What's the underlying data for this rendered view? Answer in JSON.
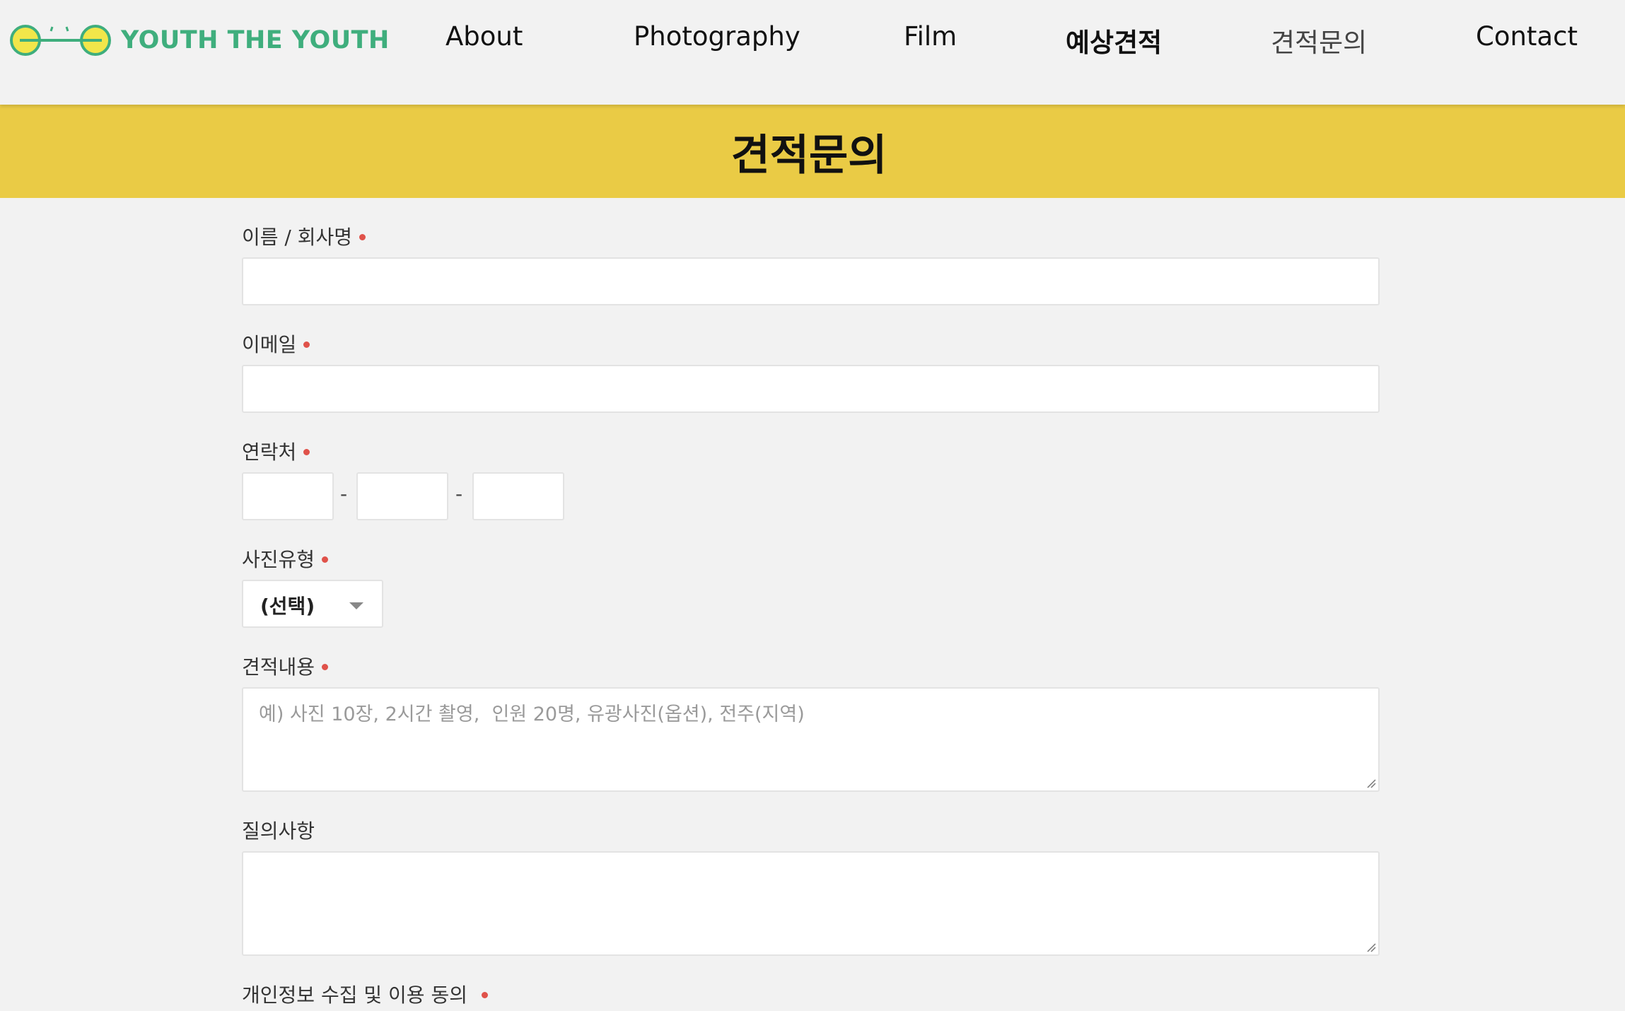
{
  "header": {
    "logo_text": "YOUTH THE YOUTH",
    "nav": [
      {
        "label": "About"
      },
      {
        "label": "Photography"
      },
      {
        "label": "Film"
      },
      {
        "label": "예상견적"
      },
      {
        "label": "견적문의"
      },
      {
        "label": "Contact"
      }
    ]
  },
  "banner": {
    "title": "견적문의"
  },
  "form": {
    "name_label": "이름 / 회사명",
    "email_label": "이메일",
    "phone_label": "연락처",
    "phone_separator": "-",
    "photo_type_label": "사진유형",
    "photo_type_selected": "(선택)",
    "quote_label": "견적내용",
    "quote_placeholder": "예) 사진 10장, 2시간 촬영,  인원 20명, 유광사진(옵션), 전주(지역)",
    "inquiry_label": "질의사항",
    "privacy_label": "개인정보 수집 및 이용 동의"
  },
  "colors": {
    "logo_green": "#3fae7d",
    "logo_yellow": "#f2e64a",
    "banner_yellow": "#eacb45",
    "required_dot": "#e0524a"
  }
}
